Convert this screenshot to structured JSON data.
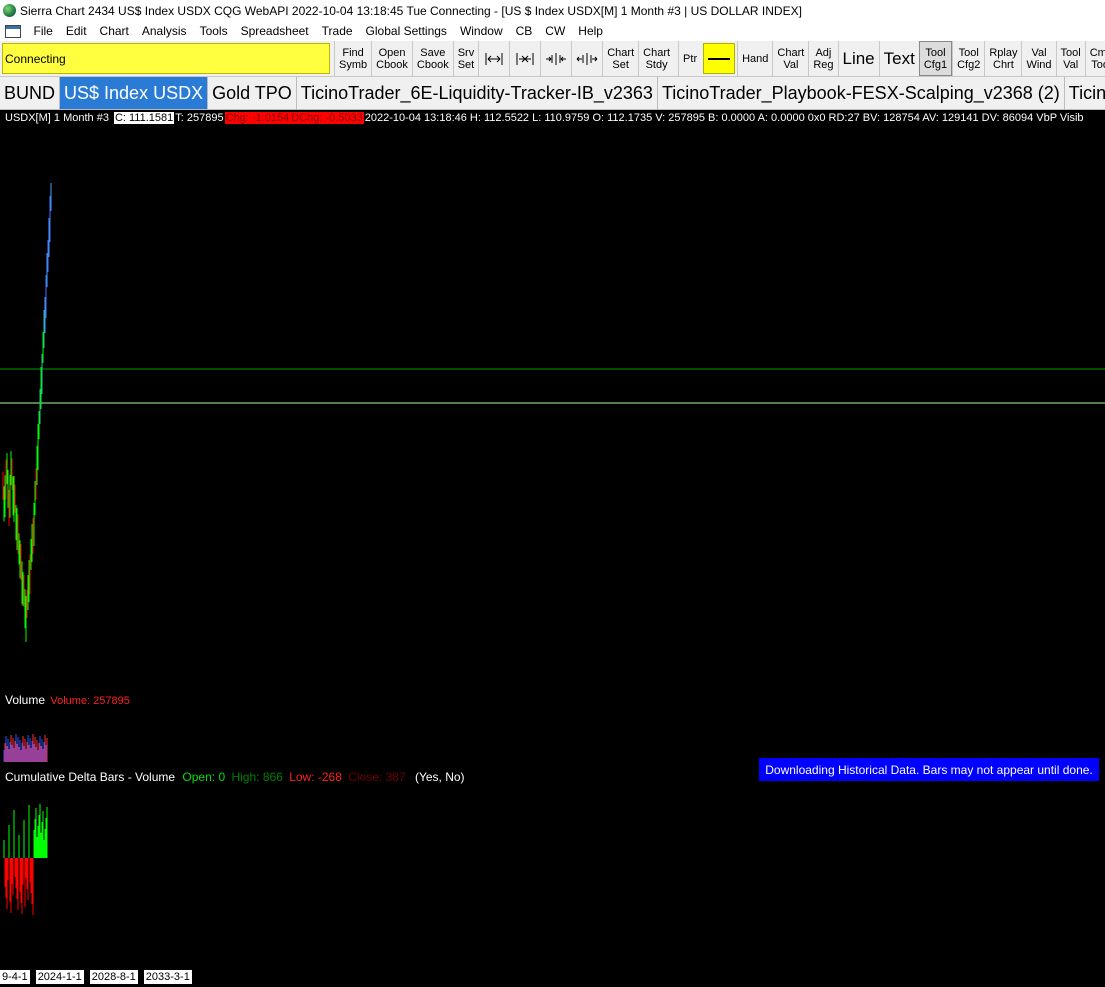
{
  "window": {
    "title": "Sierra Chart 2434 US$ Index USDX  CQG WebAPI 2022-10-04  13:18:45 Tue  Connecting - [US $ Index USDX[M]  1 Month  #3 | US DOLLAR INDEX]"
  },
  "menu": [
    "File",
    "Edit",
    "Chart",
    "Analysis",
    "Tools",
    "Spreadsheet",
    "Trade",
    "Global Settings",
    "Window",
    "CB",
    "CW",
    "Help"
  ],
  "toolbar": {
    "status": "Connecting",
    "buttons": [
      {
        "top": "Find",
        "bottom": "Symb"
      },
      {
        "top": "Open",
        "bottom": "Cbook"
      },
      {
        "top": "Save",
        "bottom": "Cbook"
      },
      {
        "top": "Srv",
        "bottom": "Set"
      },
      {
        "top": "Chart",
        "bottom": "Set"
      },
      {
        "top": "Chart",
        "bottom": "Stdy"
      },
      {
        "label": "Ptr"
      },
      {
        "label": "Hand"
      },
      {
        "top": "Chart",
        "bottom": "Val"
      },
      {
        "top": "Adj",
        "bottom": "Reg"
      },
      {
        "label": "Line"
      },
      {
        "label": "Text"
      },
      {
        "top": "Tool",
        "bottom": "Cfg1"
      },
      {
        "top": "Tool",
        "bottom": "Cfg2"
      },
      {
        "top": "Rplay",
        "bottom": "Chrt"
      },
      {
        "top": "Val",
        "bottom": "Wind"
      },
      {
        "top": "Tool",
        "bottom": "Val"
      },
      {
        "top": "Cmp",
        "bottom": "Tool"
      }
    ],
    "highlight_color": "#ffff00"
  },
  "tabs": [
    "BUND",
    "US$ Index USDX",
    "Gold TPO",
    "TicinoTrader_6E-Liquidity-Tracker-IB_v2363",
    "TicinoTrader_Playbook-FESX-Scalping_v2368 (2)",
    "TicinoTrader"
  ],
  "chart_header": {
    "symbol": "USDX[M]  1 Month  #3",
    "close": "C: 111.1581",
    "trades": "T: 257895",
    "chg": "Chg: -1.0154",
    "dchg": "DChg: -0.5033",
    "details": "2022-10-04 13:18:46 H: 112.5522 L: 110.9759 O: 112.1735 V: 257895 B: 0.0000 A: 0.0000 0x0 RD:27 BV: 128754 AV: 129141 DV: 86094 VbP Visib"
  },
  "volume_study": {
    "label": "Volume",
    "value": "Volume: 257895"
  },
  "delta_study": {
    "label": "Cumulative Delta Bars - Volume",
    "open": "Open: 0",
    "high": "High: 866",
    "low": "Low: -268",
    "close": "Close: 387",
    "flags": "(Yes, No)"
  },
  "notice": "Downloading Historical Data. Bars may not appear until done.",
  "date_labels": [
    "9-4-1",
    "2024-1-1",
    "2028-8-1",
    "2033-3-1"
  ],
  "colors": {
    "up_bar": "#00ff00",
    "down_bar": "#ff0000",
    "hline_1": "#00a000",
    "hline_2": "#a0ffa0",
    "notice_bg": "#0000ff"
  }
}
